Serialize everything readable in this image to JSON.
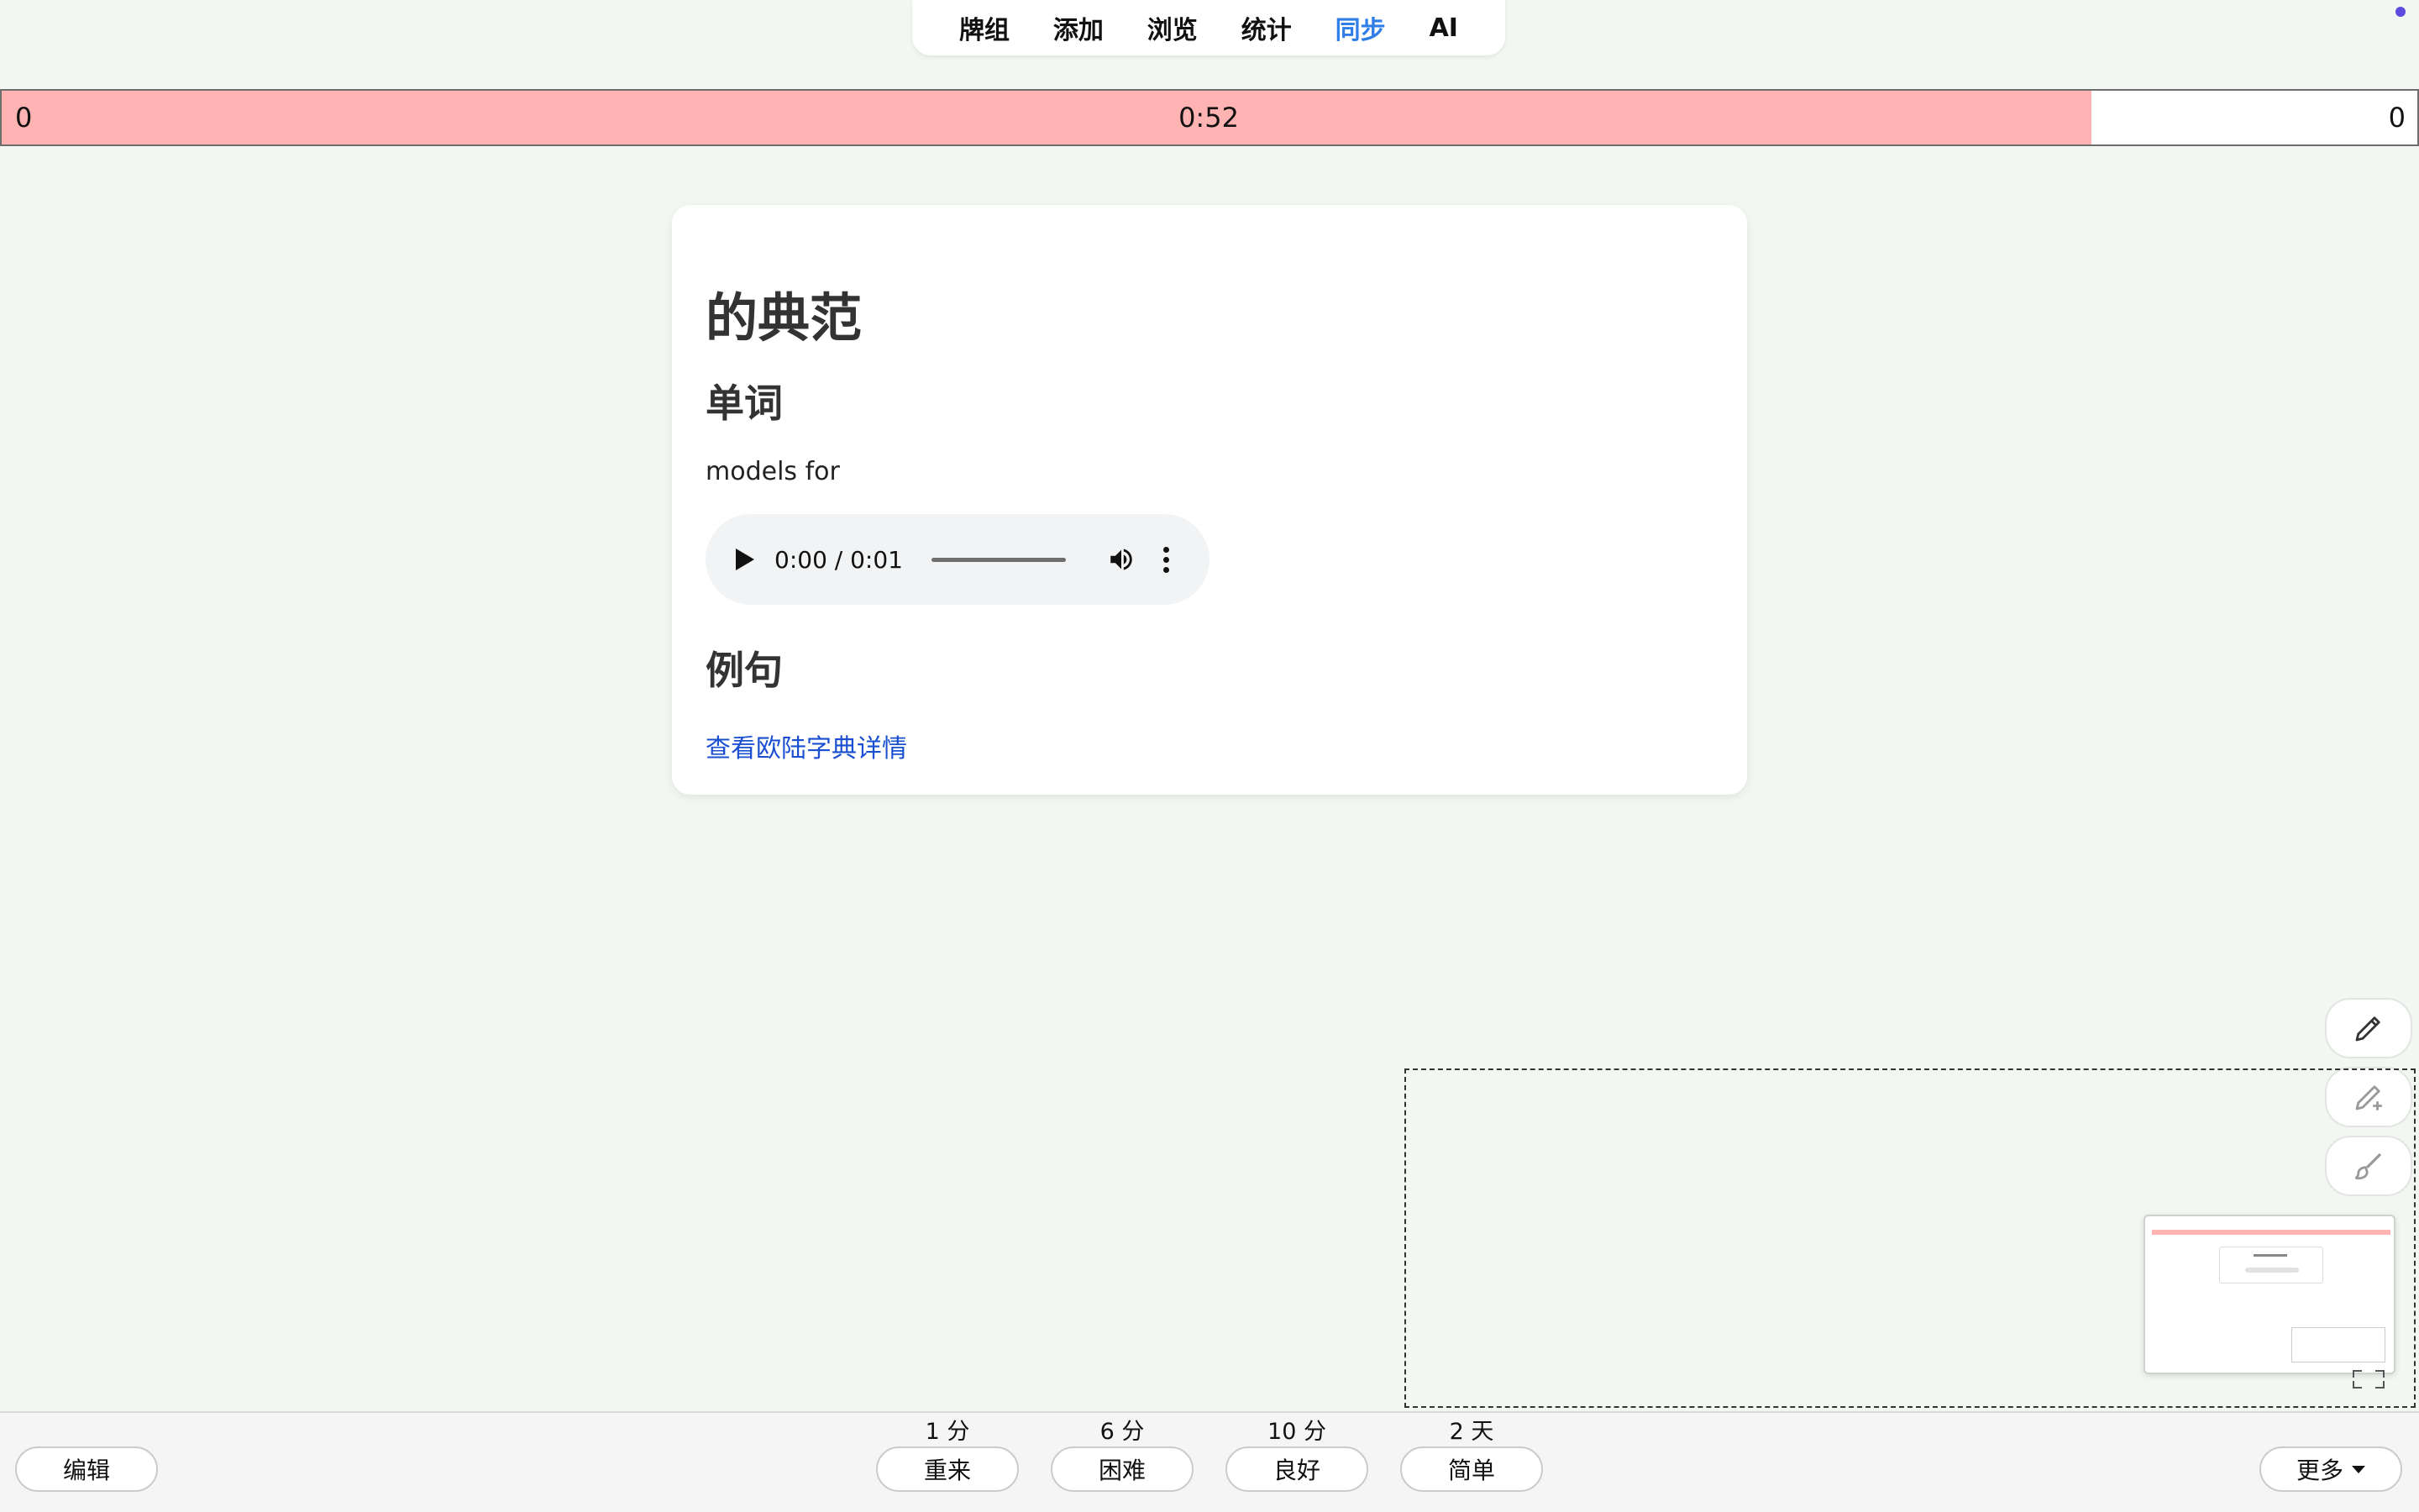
{
  "nav": {
    "items": [
      {
        "label": "牌组"
      },
      {
        "label": "添加"
      },
      {
        "label": "浏览"
      },
      {
        "label": "统计"
      },
      {
        "label": "同步"
      },
      {
        "label": "AI"
      }
    ],
    "active": "同步"
  },
  "timer": {
    "left_count": "0",
    "time": "0:52",
    "right_count": "0",
    "progress_fraction": 0.865
  },
  "card": {
    "headword": "的典范",
    "word_heading": "单词",
    "meaning": "models for",
    "audio": {
      "time": "0:00 / 0:01"
    },
    "example_heading": "例句",
    "dict_link": "查看欧陆字典详情"
  },
  "tools": [
    "pencil-icon",
    "pencil-plus-icon",
    "brush-icon"
  ],
  "bottom": {
    "edit_label": "编辑",
    "more_label": "更多",
    "answers": [
      {
        "interval": "1 分",
        "label": "重来"
      },
      {
        "interval": "6 分",
        "label": "困难"
      },
      {
        "interval": "10 分",
        "label": "良好"
      },
      {
        "interval": "2 天",
        "label": "简单"
      }
    ]
  },
  "colors": {
    "background": "#f3f7f2",
    "timer_fill": "#ffb3b3",
    "active_nav": "#2f7ee8",
    "link": "#1a4fd1"
  }
}
